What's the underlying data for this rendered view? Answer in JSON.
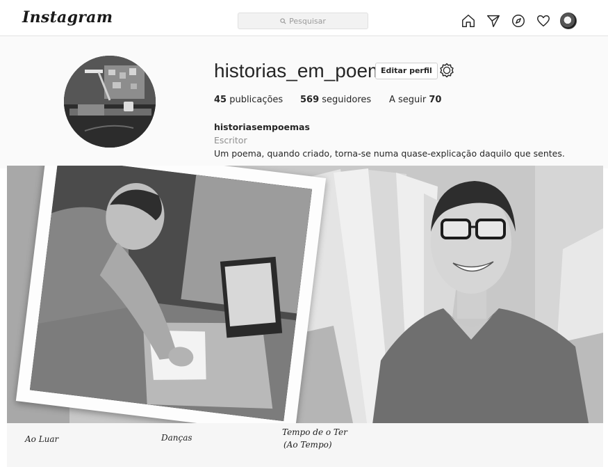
{
  "header": {
    "logo": "Instagram",
    "search_placeholder": "Pesquisar",
    "nav_icons": [
      "home-icon",
      "direct-message-icon",
      "explore-icon",
      "activity-heart-icon",
      "profile-avatar"
    ]
  },
  "profile": {
    "username": "historias_em_poemas",
    "edit_button": "Editar perfil",
    "stats": {
      "posts_count": "45",
      "posts_label": "publicações",
      "followers_count": "569",
      "followers_label": "seguidores",
      "following_label": "A seguir",
      "following_count": "70"
    },
    "bio": {
      "name": "historiasempoemas",
      "category": "Escritor",
      "text": "Um poema, quando criado, torna-se numa quase-explicação daquilo que sentes."
    }
  },
  "posts": {
    "captions": [
      "Ao Luar",
      "Danças",
      "Tempo de o Ter",
      "(Ao Tempo)"
    ]
  }
}
